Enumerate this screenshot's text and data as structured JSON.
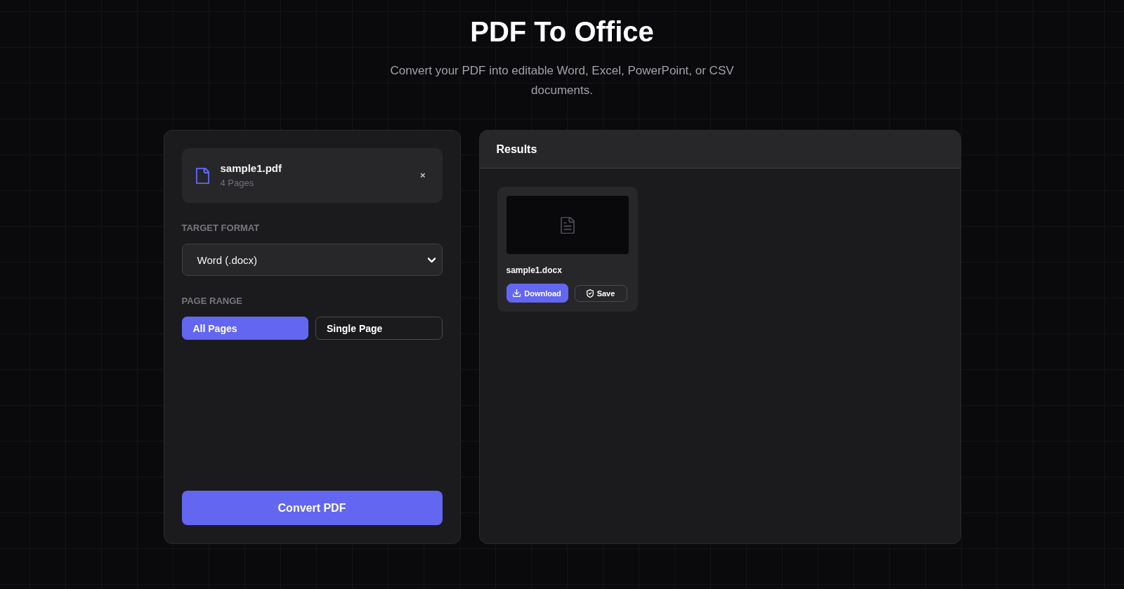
{
  "header": {
    "title": "PDF To Office",
    "subtitle": "Convert your PDF into editable Word, Excel, PowerPoint, or CSV documents."
  },
  "file": {
    "name": "sample1.pdf",
    "pages": "4 Pages",
    "remove": "×"
  },
  "target_format": {
    "label": "TARGET FORMAT",
    "value": "Word (.docx)"
  },
  "page_range": {
    "label": "PAGE RANGE",
    "options": [
      {
        "label": "All Pages",
        "selected": true
      },
      {
        "label": "Single Page",
        "selected": false
      }
    ]
  },
  "convert_button": "Convert PDF",
  "results": {
    "title": "Results",
    "items": [
      {
        "name": "sample1.docx",
        "actions": [
          {
            "kind": "download",
            "label": "Download"
          },
          {
            "kind": "save",
            "label": "Save"
          }
        ]
      }
    ]
  }
}
